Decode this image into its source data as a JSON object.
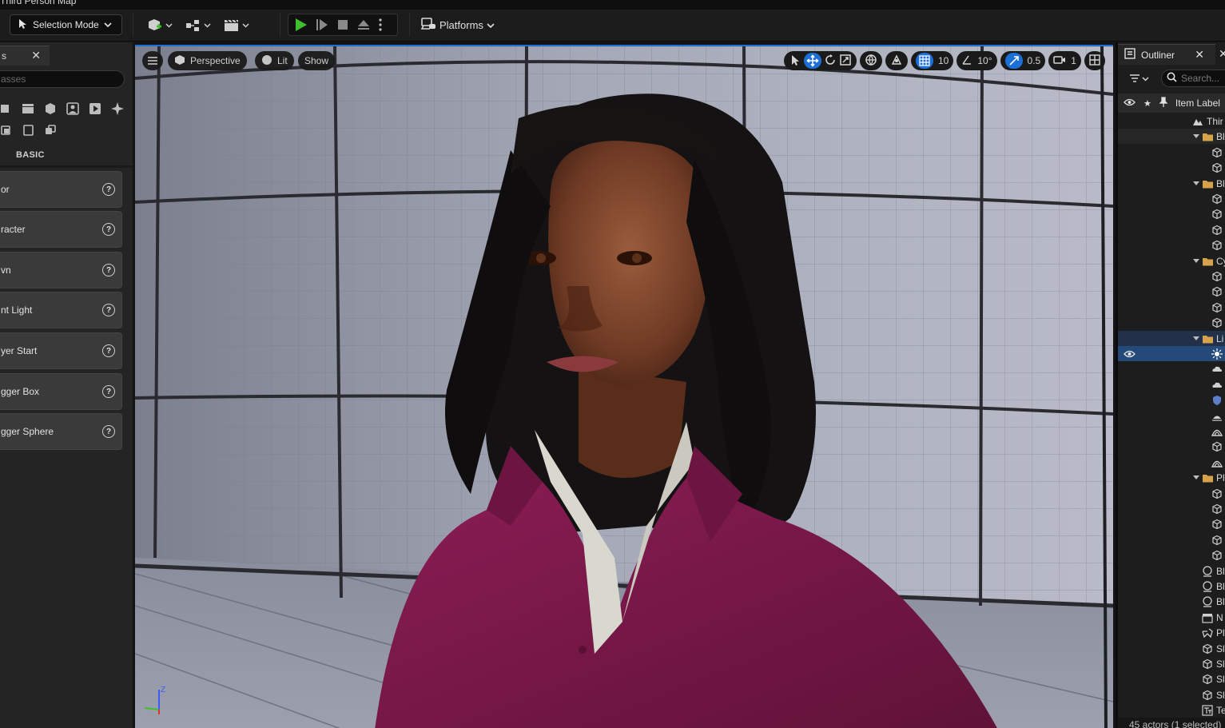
{
  "menu": {
    "title": "Third Person Map"
  },
  "toolbar": {
    "mode_label": "Selection Mode",
    "platforms_label": "Platforms"
  },
  "place_actors": {
    "tab_label": "s",
    "search_placeholder": "asses",
    "category_label": "BASIC",
    "items": [
      {
        "label": "or"
      },
      {
        "label": "racter"
      },
      {
        "label": "vn"
      },
      {
        "label": "nt Light"
      },
      {
        "label": "yer Start"
      },
      {
        "label": "gger Box"
      },
      {
        "label": "gger Sphere"
      }
    ]
  },
  "viewport": {
    "perspective_label": "Perspective",
    "lit_label": "Lit",
    "show_label": "Show",
    "grid_snap": "10",
    "rotation_snap": "10°",
    "scale_snap": "0.5",
    "camera_speed": "1",
    "axis_z": "Z"
  },
  "outliner": {
    "tab_label": "Outliner",
    "search_placeholder": "Search...",
    "header_label": "Item Label",
    "rows": [
      {
        "label": "Thir",
        "icon": "map-icon"
      },
      {
        "label": "Bl",
        "icon": "folder-icon"
      },
      {
        "label": "",
        "icon": "cube-icon"
      },
      {
        "label": "",
        "icon": "cube-icon"
      },
      {
        "label": "Bl",
        "icon": "folder-icon"
      },
      {
        "label": "",
        "icon": "cube-icon"
      },
      {
        "label": "",
        "icon": "cube-icon"
      },
      {
        "label": "",
        "icon": "cube-icon"
      },
      {
        "label": "",
        "icon": "cube-icon"
      },
      {
        "label": "Cy",
        "icon": "folder-icon"
      },
      {
        "label": "",
        "icon": "cube-icon"
      },
      {
        "label": "",
        "icon": "cube-icon"
      },
      {
        "label": "",
        "icon": "cube-icon"
      },
      {
        "label": "",
        "icon": "cube-icon"
      },
      {
        "label": "Li",
        "icon": "folder-icon"
      },
      {
        "label": "",
        "icon": "light-icon"
      },
      {
        "label": "",
        "icon": "cloud-icon"
      },
      {
        "label": "",
        "icon": "cloud-icon"
      },
      {
        "label": "",
        "icon": "shield-icon"
      },
      {
        "label": "",
        "icon": "sun-icon"
      },
      {
        "label": "",
        "icon": "sky-icon"
      },
      {
        "label": "",
        "icon": "cube-icon"
      },
      {
        "label": "",
        "icon": "sky-icon"
      },
      {
        "label": "Pl",
        "icon": "folder-icon"
      },
      {
        "label": "",
        "icon": "cube-icon"
      },
      {
        "label": "",
        "icon": "cube-icon"
      },
      {
        "label": "",
        "icon": "cube-icon"
      },
      {
        "label": "",
        "icon": "cube-icon"
      },
      {
        "label": "",
        "icon": "cube-icon"
      },
      {
        "label": "Bl",
        "icon": "sphere-icon"
      },
      {
        "label": "Bl",
        "icon": "sphere-icon"
      },
      {
        "label": "Bl",
        "icon": "sphere-icon"
      },
      {
        "label": "N",
        "icon": "clapper-icon"
      },
      {
        "label": "Pl",
        "icon": "gamepad-icon"
      },
      {
        "label": "Sl",
        "icon": "cube-icon"
      },
      {
        "label": "Sl",
        "icon": "cube-icon"
      },
      {
        "label": "Sl",
        "icon": "cube-icon"
      },
      {
        "label": "Sl",
        "icon": "cube-icon"
      },
      {
        "label": "Te",
        "icon": "text-icon"
      }
    ],
    "footer_label": "45 actors (1 selected)"
  },
  "colors": {
    "accent": "#1d6fd8",
    "play_green": "#3fbf2f",
    "shirt": "#7a1848"
  }
}
